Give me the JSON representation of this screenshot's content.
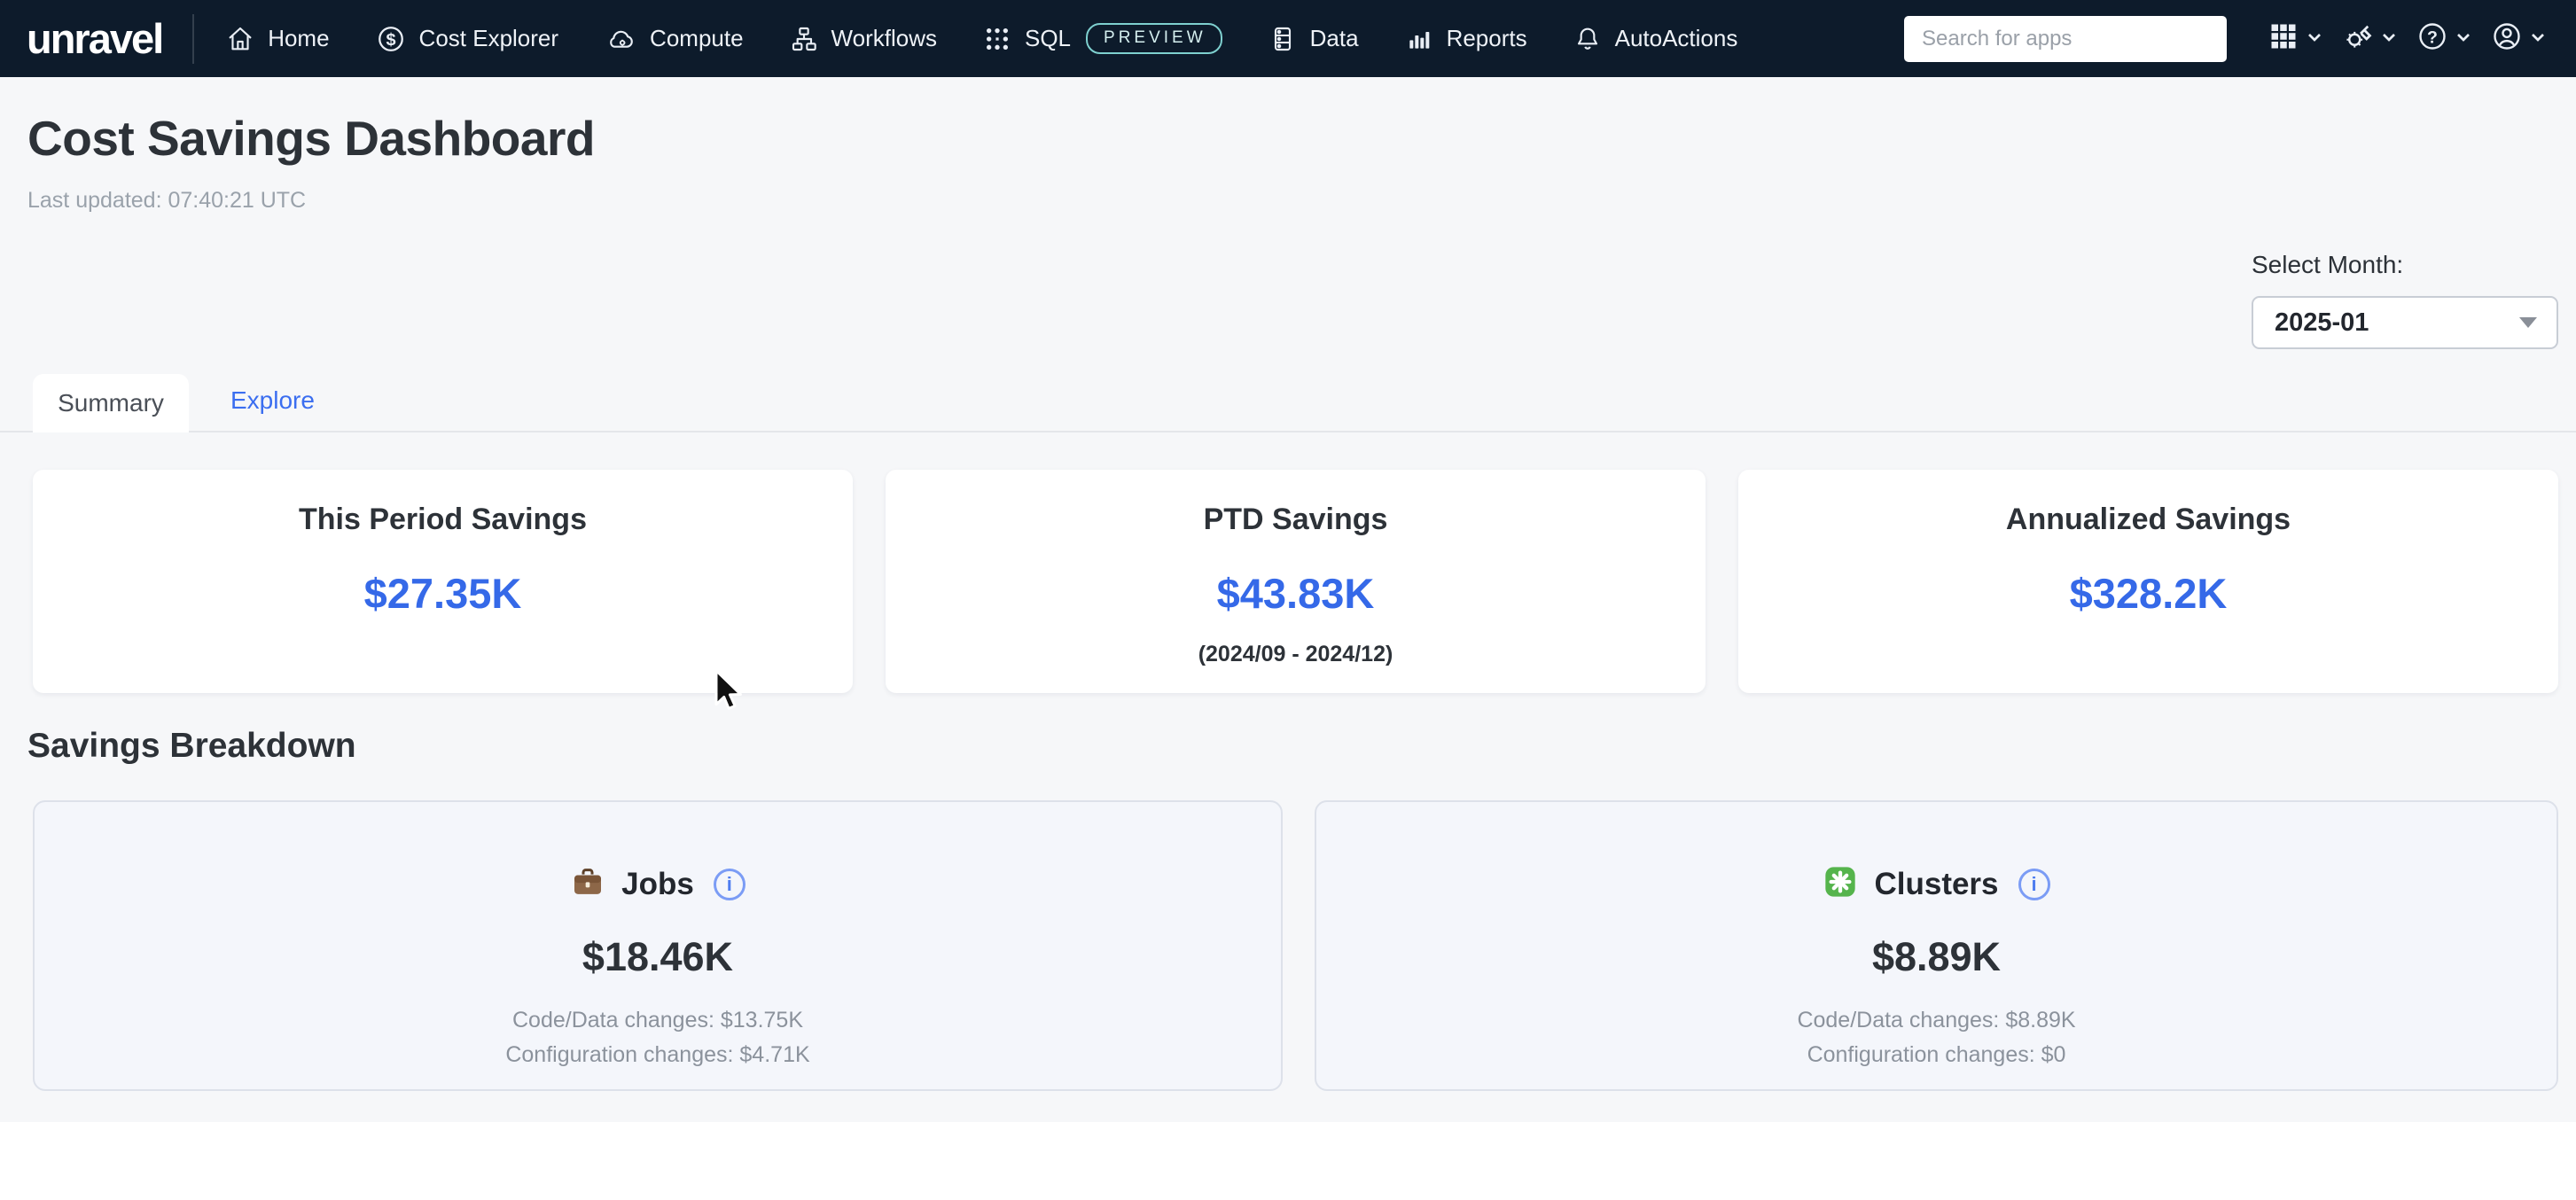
{
  "navbar": {
    "logo_text": "unravel",
    "search_placeholder": "Search for apps",
    "items": [
      {
        "label": "Home",
        "icon": "home-icon"
      },
      {
        "label": "Cost Explorer",
        "icon": "dollar-circle-icon"
      },
      {
        "label": "Compute",
        "icon": "cloud-compute-icon"
      },
      {
        "label": "Workflows",
        "icon": "workflow-icon"
      },
      {
        "label": "SQL",
        "icon": "sql-pattern-icon",
        "badge": "PREVIEW"
      },
      {
        "label": "Data",
        "icon": "database-icon"
      },
      {
        "label": "Reports",
        "icon": "bar-chart-icon"
      },
      {
        "label": "AutoActions",
        "icon": "bell-icon"
      }
    ]
  },
  "icons": {
    "dollar_glyph": "$",
    "help_glyph": "?",
    "info_glyph": "i"
  },
  "header": {
    "title": "Cost Savings Dashboard",
    "last_updated": "Last updated: 07:40:21 UTC"
  },
  "filters": {
    "label": "Select Month:",
    "value": "2025-01"
  },
  "tabs": [
    {
      "label": "Summary",
      "active": true
    },
    {
      "label": "Explore",
      "active": false
    }
  ],
  "summary_cards": [
    {
      "title": "This Period Savings",
      "value": "$27.35K",
      "subtitle": ""
    },
    {
      "title": "PTD Savings",
      "value": "$43.83K",
      "subtitle": "(2024/09 - 2024/12)"
    },
    {
      "title": "Annualized Savings",
      "value": "$328.2K",
      "subtitle": ""
    }
  ],
  "breakdown": {
    "heading": "Savings Breakdown",
    "cards": [
      {
        "icon": "briefcase-icon",
        "title": "Jobs",
        "value": "$18.46K",
        "line1": "Code/Data changes: $13.75K",
        "line2": "Configuration changes: $4.71K"
      },
      {
        "icon": "green-asterisk-icon",
        "title": "Clusters",
        "value": "$8.89K",
        "line1": "Code/Data changes: $8.89K",
        "line2": "Configuration changes: $0"
      }
    ]
  },
  "colors": {
    "navbar_bg": "#0d1b2b",
    "accent_blue": "#3569e8",
    "value_dark": "#2d3238",
    "muted_text": "#8b929c",
    "preview_badge_border": "#7ed0cf",
    "clusters_green": "#55b44c",
    "page_bg": "#f6f7f9",
    "breakdown_card_bg": "#f4f6fb"
  }
}
